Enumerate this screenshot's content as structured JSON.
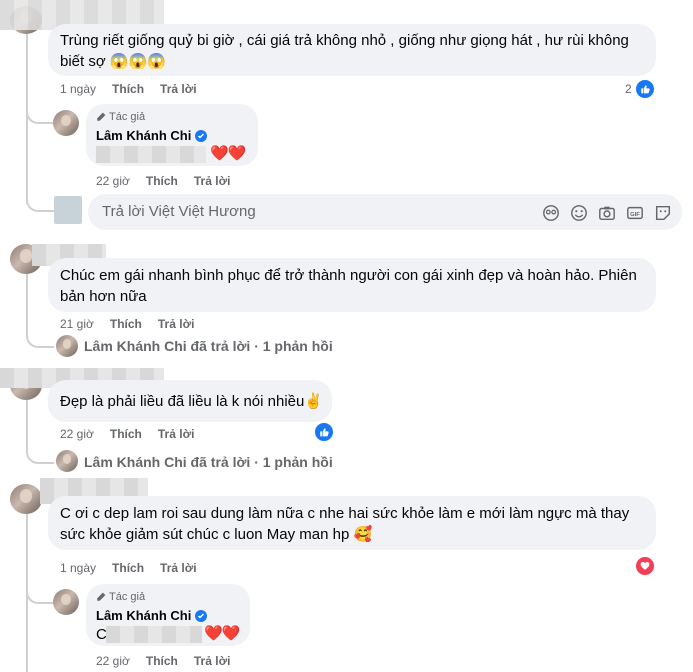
{
  "comments": [
    {
      "text": "Trùng riết giống quỷ bi giờ , cái giá trả không nhỏ , giống như giọng hát , hư rùi không biết sợ 😱😱😱",
      "time": "1 ngày",
      "like_label": "Thích",
      "reply_label": "Trả lời",
      "reaction_count": "2",
      "reaction": "like-icon",
      "author_reply": {
        "tag": "Tác giả",
        "name": "Lâm Khánh Chi",
        "hearts": "❤️❤️",
        "time": "22 giờ",
        "like_label": "Thích",
        "reply_label": "Trả lời"
      },
      "reply_placeholder": "Trả lời Việt Việt Hương"
    },
    {
      "text": "Chúc em gái nhanh bình phục để trở thành người con gái xinh đẹp và hoàn hảo. Phiên bản hơn nữa",
      "time": "21 giờ",
      "like_label": "Thích",
      "reply_label": "Trả lời",
      "replied_summary": "Lâm Khánh Chi đã trả lời · 1 phản hồi"
    },
    {
      "text": "Đẹp là phải liều đã liều là k nói nhiều✌️",
      "time": "22 giờ",
      "like_label": "Thích",
      "reply_label": "Trả lời",
      "reaction": "like-icon",
      "replied_summary": "Lâm Khánh Chi đã trả lời · 1 phản hồi"
    },
    {
      "text": "C ơi c dep lam roi sau dung làm nữa c nhe hai sức khỏe làm e mới làm ngực mà thay sức khỏe giảm sút chúc c luon May man hp 🥰",
      "time": "1 ngày",
      "like_label": "Thích",
      "reply_label": "Trả lời",
      "reaction": "heart-icon",
      "author_reply": {
        "tag": "Tác giả",
        "name": "Lâm Khánh Chi",
        "prefix": "C",
        "hearts": "❤️❤️",
        "time": "22 giờ",
        "like_label": "Thích",
        "reply_label": "Trả lời"
      }
    }
  ],
  "colors": {
    "bubble": "#f0f2f5",
    "meta_text": "#65676b",
    "like_blue": "#1877f2",
    "heart_red": "#f33e58"
  }
}
